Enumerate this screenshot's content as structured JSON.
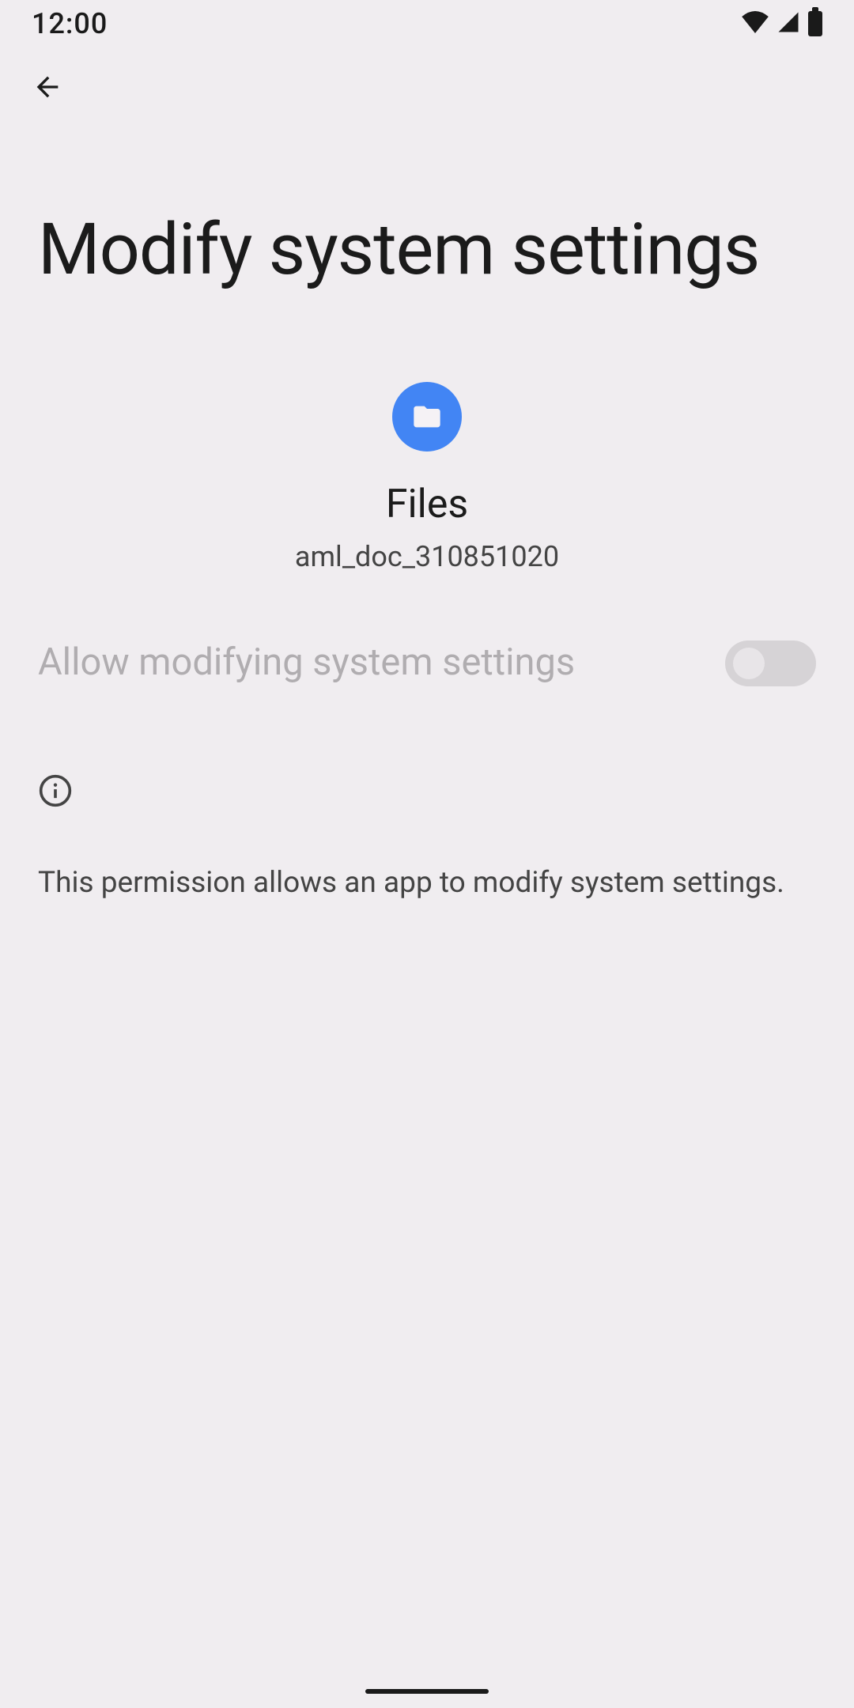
{
  "status": {
    "time": "12:00"
  },
  "header": {
    "title": "Modify system settings"
  },
  "app": {
    "name": "Files",
    "version": "aml_doc_310851020"
  },
  "permission": {
    "label": "Allow modifying system settings",
    "enabled": false
  },
  "info": {
    "description": "This permission allows an app to modify system settings."
  }
}
